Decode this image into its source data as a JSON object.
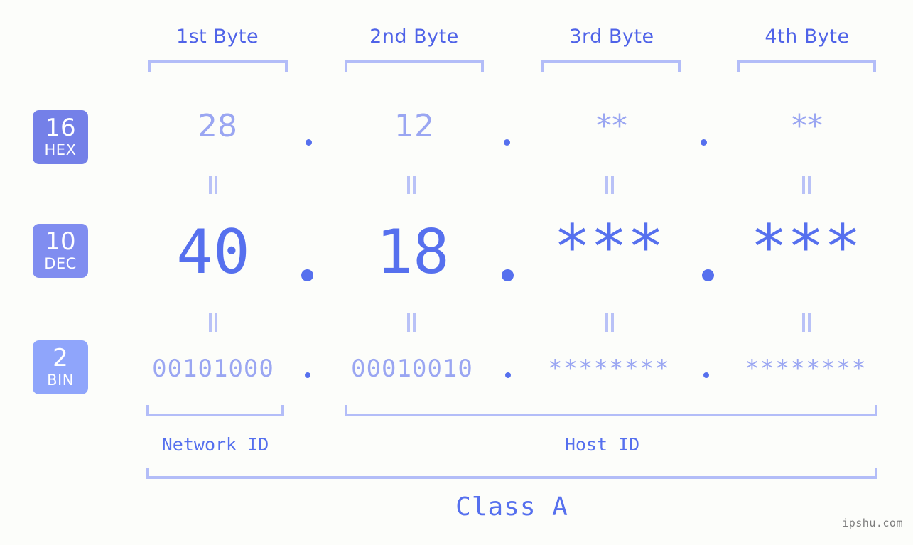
{
  "watermark": "ipshu.com",
  "headers": [
    {
      "label": "1st Byte"
    },
    {
      "label": "2nd Byte"
    },
    {
      "label": "3rd Byte"
    },
    {
      "label": "4th Byte"
    }
  ],
  "bases": [
    {
      "num": "16",
      "label": "HEX",
      "color": "#7480e8"
    },
    {
      "num": "10",
      "label": "DEC",
      "color": "#808df0"
    },
    {
      "num": "2",
      "label": "BIN",
      "color": "#8fa5fb"
    }
  ],
  "rows": {
    "hex": {
      "values": [
        "28",
        "12",
        "**",
        "**"
      ]
    },
    "dec": {
      "values": [
        "40",
        "18",
        "***",
        "***"
      ]
    },
    "bin": {
      "values": [
        "00101000",
        "00010010",
        "********",
        "********"
      ]
    }
  },
  "separator": ".",
  "equals_symbol": "=",
  "sections": {
    "network_id": "Network ID",
    "host_id": "Host ID",
    "class": "Class A"
  },
  "colors": {
    "background": "#fcfdfa",
    "accent_strong": "#5670ee",
    "accent_light": "#9aa6f2",
    "bracket": "#b3bdf8",
    "header_text": "#4f63e8",
    "watermark_text": "#7d7d7d"
  }
}
